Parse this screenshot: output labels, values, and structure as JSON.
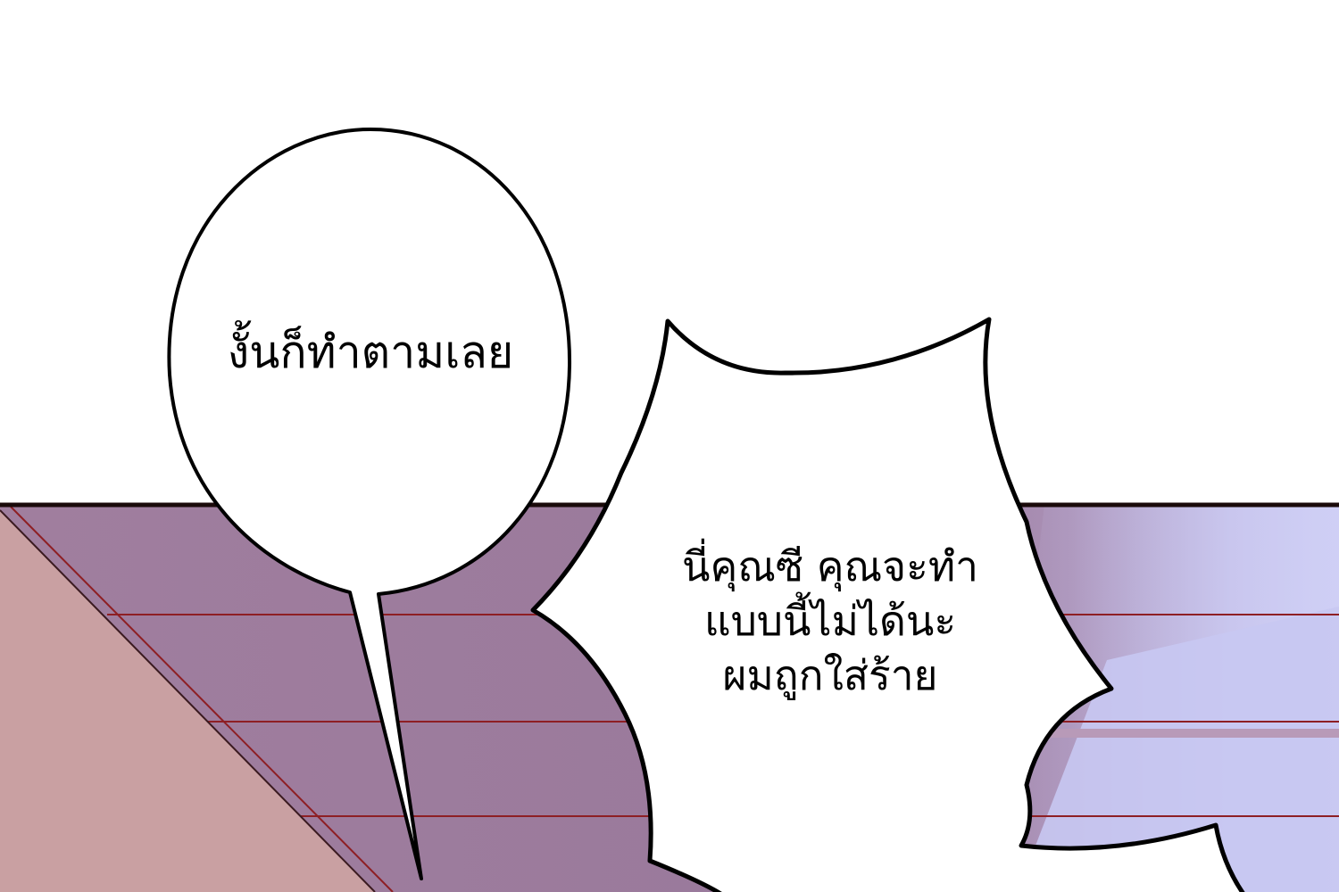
{
  "panel": {
    "bubbles": [
      {
        "shape": "oval",
        "lines": [
          "งั้นก็ทำตามเลย"
        ]
      },
      {
        "shape": "spiky",
        "lines": [
          "นี่คุณซี คุณจะทำ",
          "แบบนี้ไม่ได้นะ",
          "ผมถูกใส่ร้าย"
        ]
      }
    ]
  },
  "colors": {
    "sky": "#ffffff",
    "floor_purple": "#9a7c9c",
    "floor_pink": "#c9a1a3",
    "floor_lavender": "#c7c7f0",
    "floor_lines": "#8a1a1a",
    "outline": "#000000",
    "bubble_fill": "#ffffff"
  }
}
